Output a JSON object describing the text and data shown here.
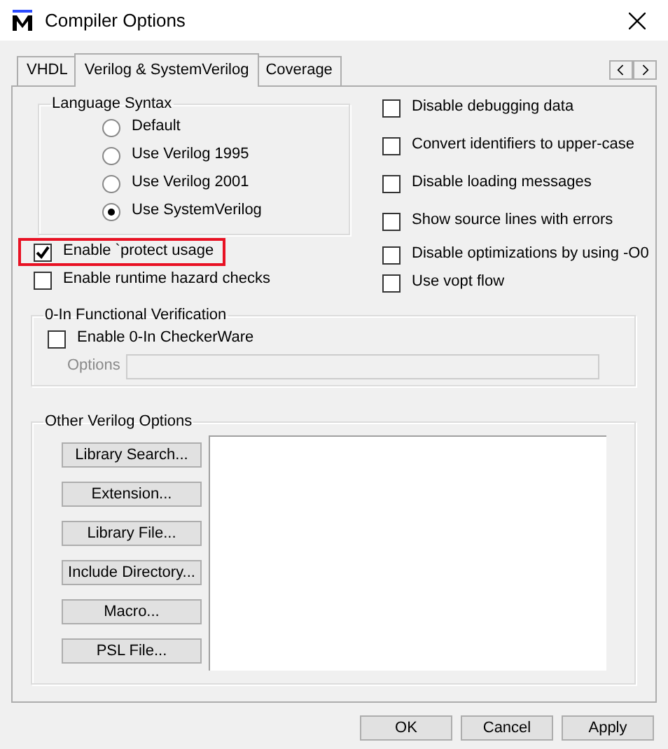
{
  "window": {
    "title": "Compiler Options"
  },
  "tabs": [
    {
      "label": "VHDL",
      "selected": false
    },
    {
      "label": "Verilog & SystemVerilog",
      "selected": true
    },
    {
      "label": "Coverage",
      "selected": false
    }
  ],
  "language_syntax": {
    "title": "Language Syntax",
    "options": [
      {
        "label": "Default",
        "selected": false
      },
      {
        "label": "Use Verilog 1995",
        "selected": false
      },
      {
        "label": "Use Verilog 2001",
        "selected": false
      },
      {
        "label": "Use SystemVerilog",
        "selected": true
      }
    ]
  },
  "left_options": [
    {
      "label": "Enable `protect usage",
      "checked": true,
      "highlighted": true
    },
    {
      "label": "Enable runtime hazard checks",
      "checked": false,
      "highlighted": false
    }
  ],
  "right_options": [
    {
      "label": "Disable debugging data",
      "checked": false
    },
    {
      "label": "Convert identifiers to upper-case",
      "checked": false
    },
    {
      "label": "Disable loading messages",
      "checked": false
    },
    {
      "label": "Show source lines with errors",
      "checked": false
    },
    {
      "label": "Disable optimizations by using -O0",
      "checked": false
    },
    {
      "label": "Use vopt flow",
      "checked": false
    }
  ],
  "zero_in": {
    "title": "0-In Functional Verification",
    "checkbox": {
      "label": "Enable 0-In CheckerWare",
      "checked": false
    },
    "options_field": {
      "label": "Options",
      "disabled": true
    }
  },
  "other_verilog": {
    "title": "Other Verilog Options",
    "buttons": [
      "Library Search...",
      "Extension...",
      "Library File...",
      "Include Directory...",
      "Macro...",
      "PSL File..."
    ]
  },
  "footer_buttons": [
    "OK",
    "Cancel",
    "Apply"
  ]
}
